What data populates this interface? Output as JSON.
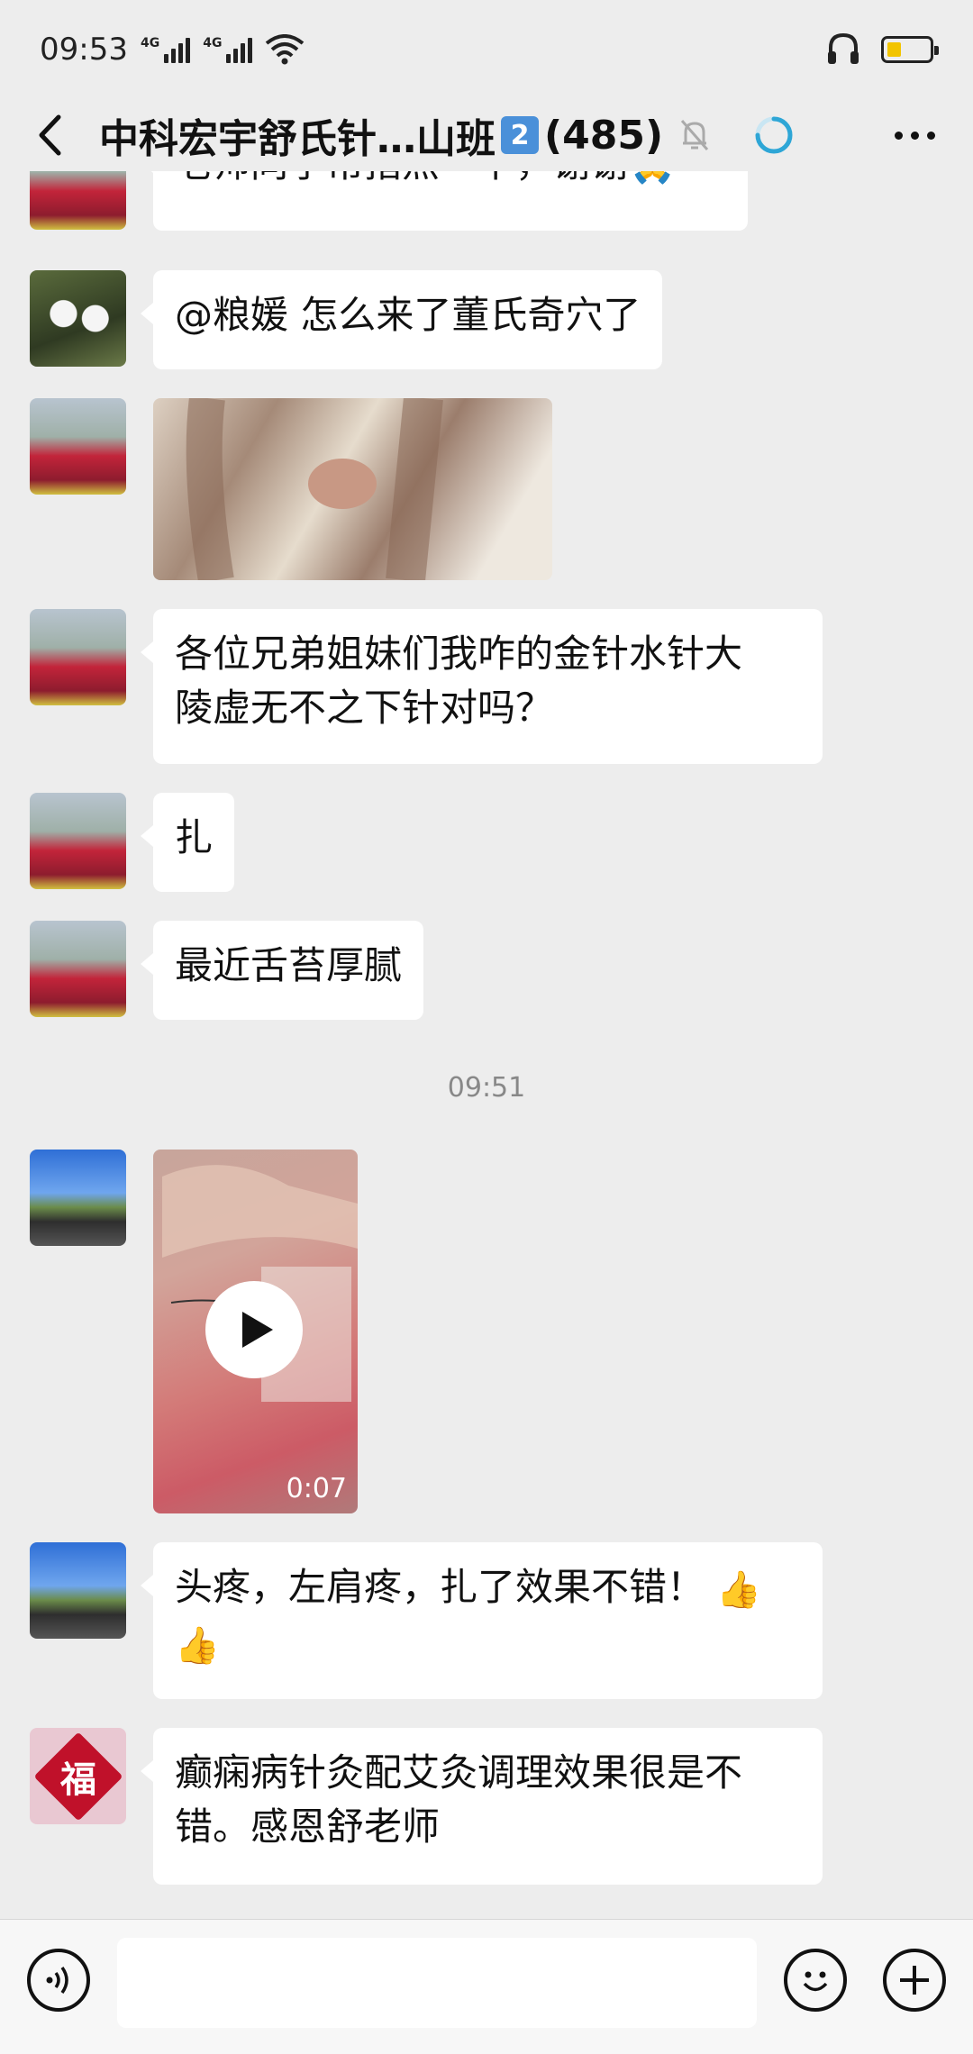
{
  "status_bar": {
    "time": "09:53",
    "net1": "4G",
    "net2": "4G"
  },
  "header": {
    "title": "中科宏宇舒氏针…山班",
    "badge": "2",
    "count": "(485)"
  },
  "messages": [
    {
      "type": "text",
      "avatar": "trees",
      "text": "老师同学帮指点一下，谢谢🙏"
    },
    {
      "type": "text",
      "avatar": "panda",
      "text": "@粮媛  怎么来了董氏奇穴了"
    },
    {
      "type": "image",
      "avatar": "trees"
    },
    {
      "type": "text",
      "avatar": "trees",
      "line1": "各位兄弟姐妹们我咋的金针水针大",
      "line2": "陵虚无不之下针对吗？"
    },
    {
      "type": "text",
      "avatar": "trees",
      "text": "扎"
    },
    {
      "type": "text",
      "avatar": "trees",
      "text": "最近舌苔厚腻"
    },
    {
      "type": "time",
      "text": "09:51"
    },
    {
      "type": "video",
      "avatar": "road",
      "duration": "0:07"
    },
    {
      "type": "text",
      "avatar": "road",
      "line1": "头疼，左肩疼，扎了效果不错！",
      "emoji1": "👍",
      "emoji2": "👍"
    },
    {
      "type": "text",
      "avatar": "fu",
      "fu_char": "福",
      "line1": "癫痫病针灸配艾灸调理效果很是不",
      "line2": "错。感恩舒老师"
    }
  ],
  "input_bar": {
    "placeholder": ""
  }
}
